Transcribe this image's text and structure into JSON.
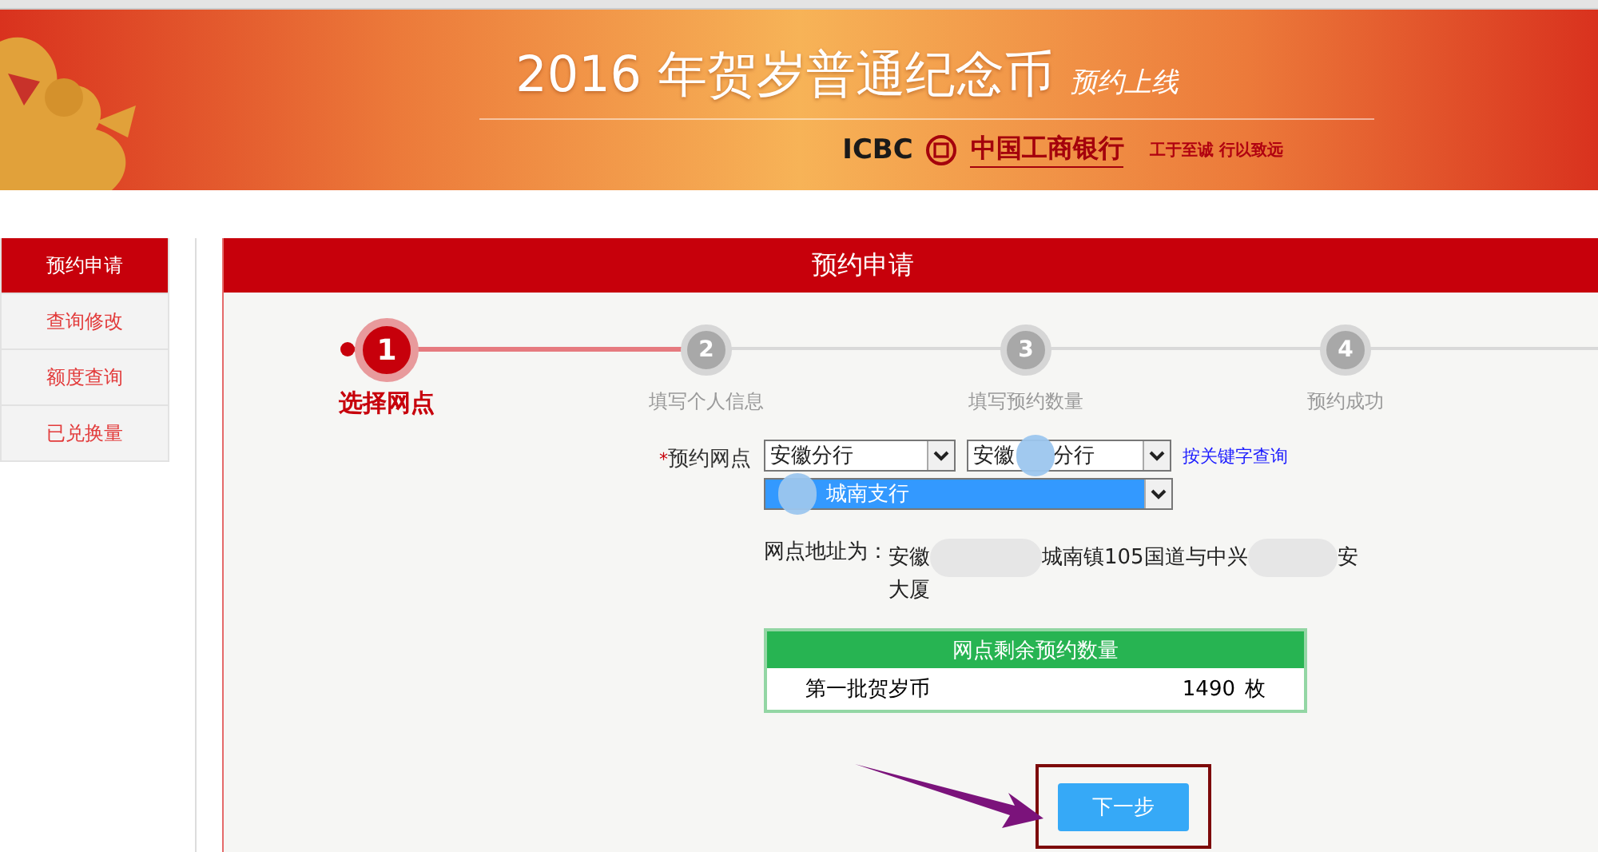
{
  "banner": {
    "title": "2016 年贺岁普通纪念币",
    "subtitle": "预约上线",
    "bank_code": "ICBC",
    "bank_name": "中国工商银行",
    "slogan": "工于至诚 行以致远"
  },
  "sidebar": {
    "items": [
      {
        "label": "预约申请",
        "selected": true
      },
      {
        "label": "查询修改",
        "selected": false
      },
      {
        "label": "额度查询",
        "selected": false
      },
      {
        "label": "已兑换量",
        "selected": false
      }
    ]
  },
  "panel": {
    "title": "预约申请"
  },
  "steps": [
    {
      "number": "1",
      "label": "选择网点",
      "active": true
    },
    {
      "number": "2",
      "label": "填写个人信息",
      "active": false
    },
    {
      "number": "3",
      "label": "填写预约数量",
      "active": false
    },
    {
      "number": "4",
      "label": "预约成功",
      "active": false
    }
  ],
  "form": {
    "required_mark": "*",
    "label": "预约网点",
    "selects": [
      {
        "parts": [
          "安徽分行"
        ],
        "highlighted": false,
        "blurred": false
      },
      {
        "parts": [
          "安徽",
          "分行"
        ],
        "highlighted": false,
        "blurred": true
      },
      {
        "parts": [
          "城南支行"
        ],
        "highlighted": true,
        "blurred": true
      }
    ],
    "keyword_link": "按关键字查询",
    "address_label": "网点地址为：",
    "address_parts": [
      "安徽",
      "城南镇105国道与中兴",
      "安大厦"
    ]
  },
  "quota_table": {
    "title": "网点剩余预约数量",
    "rows": [
      {
        "name": "第一批贺岁币",
        "count": "1490",
        "unit": "枚"
      }
    ]
  },
  "next_button": "下一步"
}
